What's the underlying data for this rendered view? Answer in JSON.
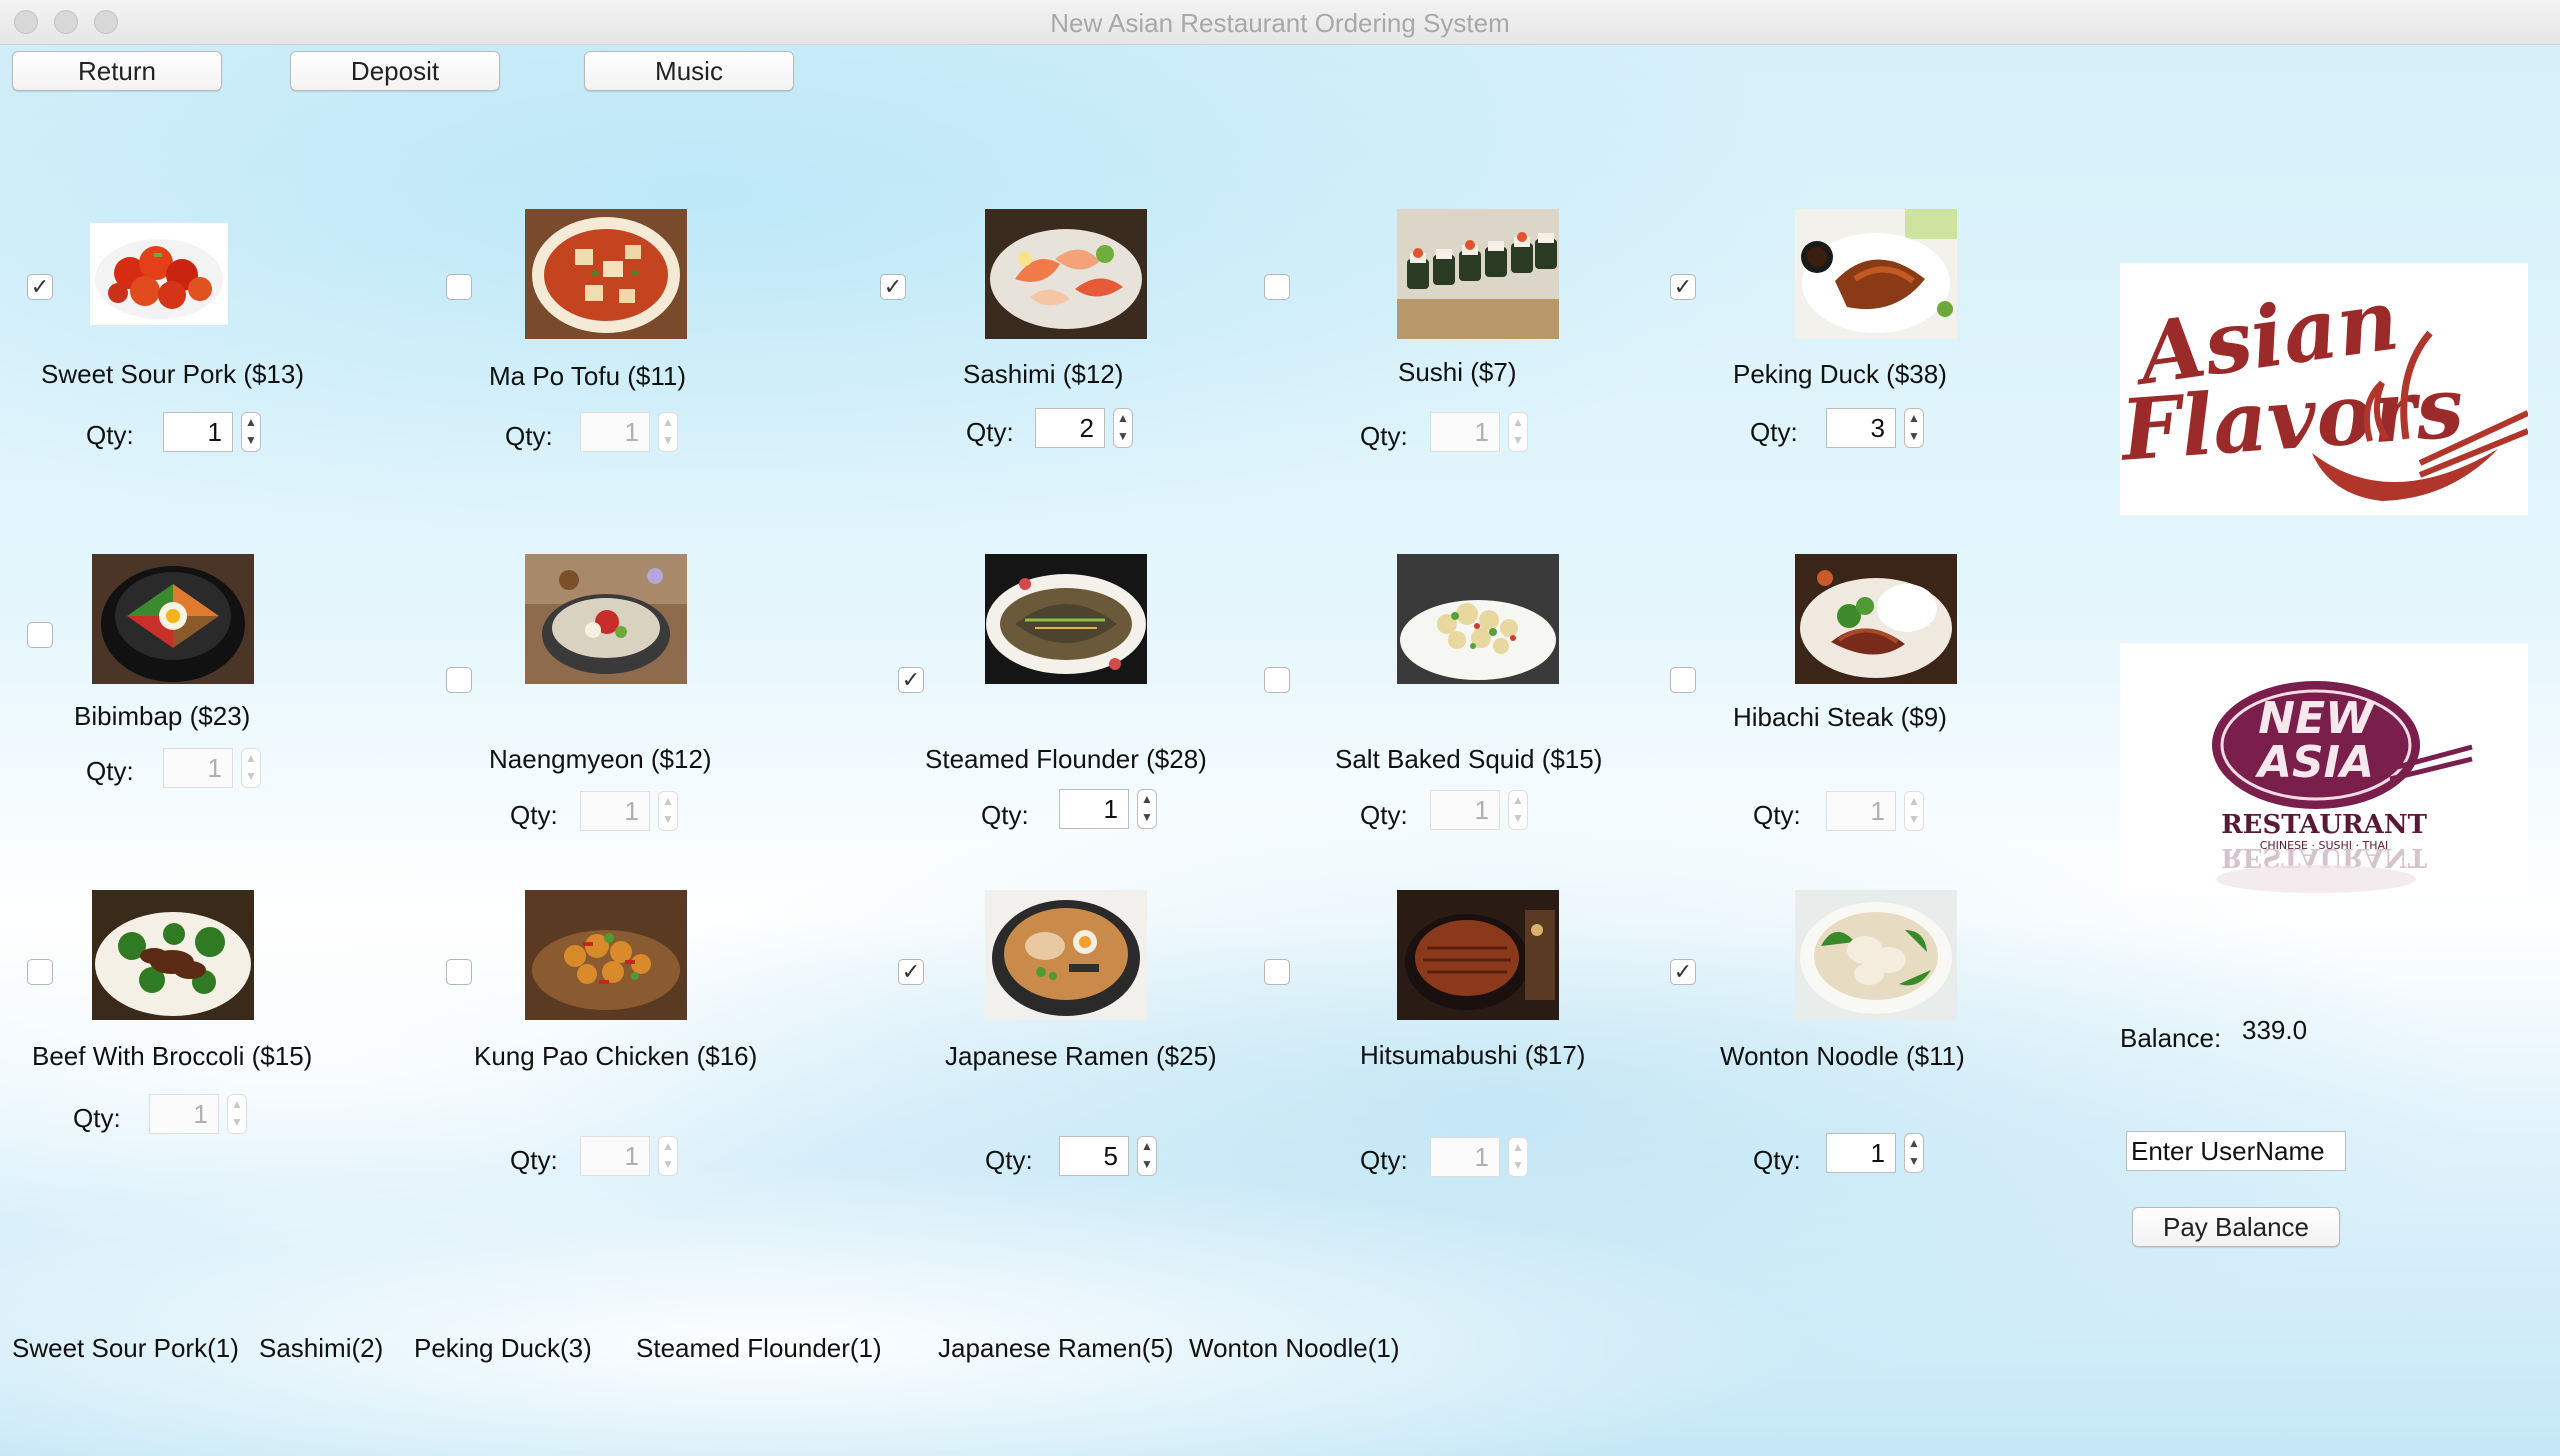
{
  "window": {
    "title": "New Asian Restaurant Ordering System"
  },
  "toolbar": {
    "return_label": "Return",
    "deposit_label": "Deposit",
    "music_label": "Music"
  },
  "qty_label": "Qty:",
  "dishes": [
    {
      "name": "Sweet Sour Pork ($13)",
      "checked": true,
      "qty": "1"
    },
    {
      "name": "Ma Po Tofu ($11)",
      "checked": false,
      "qty": "1"
    },
    {
      "name": "Sashimi ($12)",
      "checked": true,
      "qty": "2"
    },
    {
      "name": "Sushi ($7)",
      "checked": false,
      "qty": "1"
    },
    {
      "name": "Peking Duck ($38)",
      "checked": true,
      "qty": "3"
    },
    {
      "name": "Bibimbap ($23)",
      "checked": false,
      "qty": "1"
    },
    {
      "name": "Naengmyeon ($12)",
      "checked": false,
      "qty": "1"
    },
    {
      "name": "Steamed Flounder ($28)",
      "checked": true,
      "qty": "1"
    },
    {
      "name": "Salt Baked Squid ($15)",
      "checked": false,
      "qty": "1"
    },
    {
      "name": "Hibachi Steak ($9)",
      "checked": false,
      "qty": "1"
    },
    {
      "name": "Beef With Broccoli ($15)",
      "checked": false,
      "qty": "1"
    },
    {
      "name": "Kung Pao Chicken ($16)",
      "checked": false,
      "qty": "1"
    },
    {
      "name": "Japanese Ramen ($25)",
      "checked": true,
      "qty": "5"
    },
    {
      "name": "Hitsumabushi ($17)",
      "checked": false,
      "qty": "1"
    },
    {
      "name": "Wonton Noodle ($11)",
      "checked": true,
      "qty": "1"
    }
  ],
  "logos": {
    "asian_flavors": {
      "line1": "Asian",
      "line2": "Flavors"
    },
    "new_asia": {
      "line1": "NEW",
      "line2": "ASIA",
      "line3": "RESTAURANT",
      "line4": "CHINESE · SUSHI · THAI"
    }
  },
  "balance": {
    "label": "Balance:",
    "value": "339.0"
  },
  "username": {
    "value": "Enter UserName"
  },
  "pay_button": {
    "label": "Pay Balance"
  },
  "order_summary": [
    "Sweet Sour Pork(1)",
    "Sashimi(2)",
    "Peking Duck(3)",
    "Steamed Flounder(1)",
    "Japanese Ramen(5)",
    "Wonton Noodle(1)"
  ],
  "colors": {
    "background": "#e4f6fc",
    "logo_red": "#9b2a2a",
    "logo_purple": "#7a1f4c"
  },
  "icons": {
    "checkmark": "✓",
    "spin_up": "▲",
    "spin_down": "▼"
  }
}
